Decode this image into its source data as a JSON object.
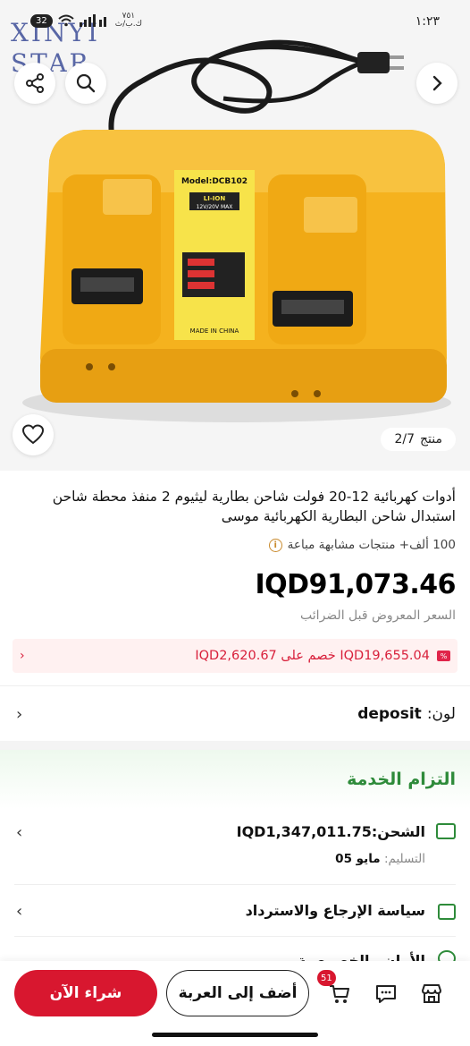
{
  "status_bar": {
    "time": "١:٢٣",
    "battery": "32",
    "network_speed_line1": "٧٥١",
    "network_speed_line2": "ك.ب/ث"
  },
  "watermark": {
    "line1": "XINYI",
    "line2": "STAR"
  },
  "image_panel": {
    "counter_word": "منتج",
    "counter_value": "2/7",
    "charger_model": "Model:DCB102",
    "charger_type": "LI-ION",
    "charger_spec": "12V/20V MAX",
    "charger_origin": "MADE IN CHINA"
  },
  "product": {
    "title": "أدوات كهربائية 12-20 فولت شاحن بطارية ليثيوم 2 منفذ محطة شاحن استبدال شاحن البطارية الكهربائية موسى",
    "similar_sold": "100 ألف+ منتجات مشابهة مباعة",
    "price": "IQD91,073.46",
    "price_note": "السعر المعروض قبل الضرائب",
    "promo_text": "IQD19,655.04 خصم على IQD2,620.67"
  },
  "color": {
    "label": "لون:",
    "value": "deposit"
  },
  "service": {
    "title": "التزام الخدمة",
    "shipping_label": "الشحن:",
    "shipping_value": "IQD1,347,011.75",
    "delivery_label": "التسليم:",
    "delivery_value": "مايو 05",
    "return_label": "سياسة الإرجاع والاسترداد",
    "privacy_label": "الأمان والخصوصية"
  },
  "bottom_bar": {
    "buy_now": "شراء الآن",
    "add_to_cart": "أضف إلى العربة",
    "cart_count": "51"
  },
  "colors": {
    "accent_red": "#d8172f",
    "service_green": "#2e8b3a",
    "charger_yellow": "#f5b21e"
  }
}
